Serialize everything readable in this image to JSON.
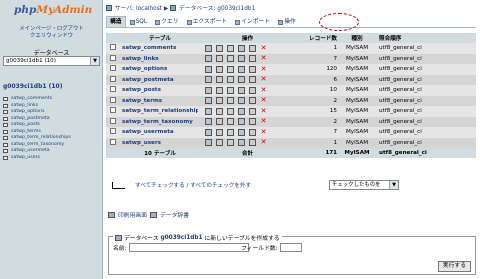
{
  "left": {
    "logo_php": "php",
    "logo_my": "MyAdmin",
    "links": [
      "メインページ・ログアウト",
      "クエリウィンドウ"
    ],
    "db_label": "データベース",
    "db_select_value": "g0039ci1db1 (10)",
    "db_title": "g0039ci1db1 (10)",
    "tables": [
      "satwp_comments",
      "satwp_links",
      "satwp_options",
      "satwp_postmeta",
      "satwp_posts",
      "satwp_terms",
      "satwp_term_relationships",
      "satwp_term_taxonomy",
      "satwp_usermeta",
      "satwp_users"
    ]
  },
  "breadcrumb": {
    "server": "サーバ: localhost",
    "sep": "▶",
    "database": "データベース: g0039ci1db1"
  },
  "tabs": [
    "構造",
    "SQL",
    "クエリ",
    "エクスポート",
    "インポート",
    "操作"
  ],
  "table_header": {
    "table": "テーブル",
    "ops": "操作",
    "records": "レコード数",
    "type": "種別",
    "collation": "照合順序"
  },
  "rows": [
    {
      "name": "satwp_comments",
      "records": "1",
      "type": "MyISAM",
      "collation": "utf8_general_ci"
    },
    {
      "name": "satwp_links",
      "records": "7",
      "type": "MyISAM",
      "collation": "utf8_general_ci"
    },
    {
      "name": "satwp_options",
      "records": "120",
      "type": "MyISAM",
      "collation": "utf8_general_ci"
    },
    {
      "name": "satwp_postmeta",
      "records": "6",
      "type": "MyISAM",
      "collation": "utf8_general_ci"
    },
    {
      "name": "satwp_posts",
      "records": "10",
      "type": "MyISAM",
      "collation": "utf8_general_ci"
    },
    {
      "name": "satwp_terms",
      "records": "2",
      "type": "MyISAM",
      "collation": "utf8_general_ci"
    },
    {
      "name": "satwp_term_relationships",
      "records": "15",
      "type": "MyISAM",
      "collation": "utf8_general_ci"
    },
    {
      "name": "satwp_term_taxonomy",
      "records": "2",
      "type": "MyISAM",
      "collation": "utf8_general_ci"
    },
    {
      "name": "satwp_usermeta",
      "records": "7",
      "type": "MyISAM",
      "collation": "utf8_general_ci"
    },
    {
      "name": "satwp_users",
      "records": "1",
      "type": "MyISAM",
      "collation": "utf8_general_ci"
    }
  ],
  "footer": {
    "count": "10 テーブル",
    "total_label": "合計",
    "records": "171",
    "type": "MyISAM",
    "collation": "utf8_general_ci"
  },
  "check_all": "すべてチェックする / すべてのチェックを外す",
  "with_selected": "チェックしたものを",
  "print_view": "印刷用画面",
  "data_dict": "データ辞書",
  "create": {
    "legend_prefix": "データベース",
    "db": "g0039ci1db1",
    "legend_suffix": "に新しいテーブルを作成する",
    "name_label": "名前:",
    "fields_label": "フィールド数:",
    "exec": "実行する"
  }
}
